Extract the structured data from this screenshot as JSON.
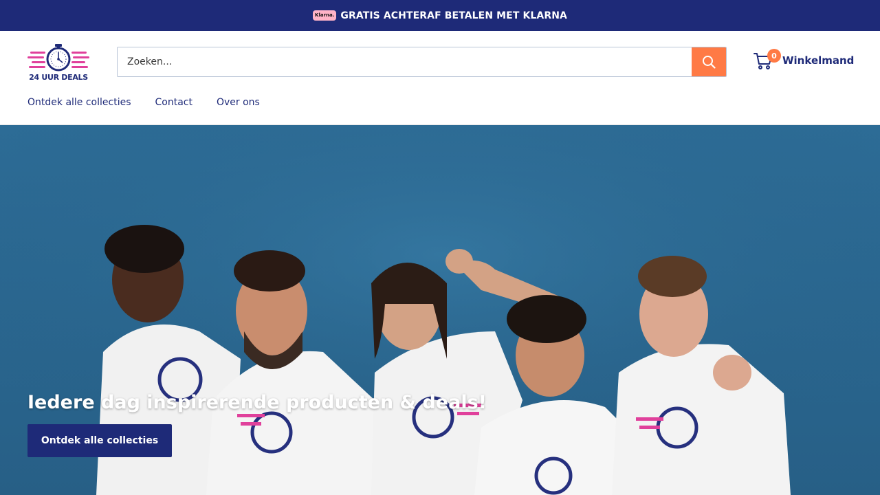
{
  "announcement": {
    "badge": "Klarna.",
    "text": "GRATIS ACHTERAF BETALEN MET KLARNA"
  },
  "brand": {
    "logo_text": "24 UUR DEALS"
  },
  "search": {
    "placeholder": "Zoeken...",
    "value": "",
    "icon": "search-icon"
  },
  "cart": {
    "icon": "cart-icon",
    "count": "0",
    "label": "Winkelmand"
  },
  "nav": {
    "items": [
      {
        "label": "Ontdek alle collecties"
      },
      {
        "label": "Contact"
      },
      {
        "label": "Over ons"
      }
    ]
  },
  "hero": {
    "title": "Iedere dag inspirerende producten & deals!",
    "button_label": "Ontdek alle collecties"
  },
  "colors": {
    "primary": "#1e2a78",
    "accent": "#ff7a45",
    "hero_bg": "#2b6a93",
    "klarna": "#ffb3c7"
  }
}
